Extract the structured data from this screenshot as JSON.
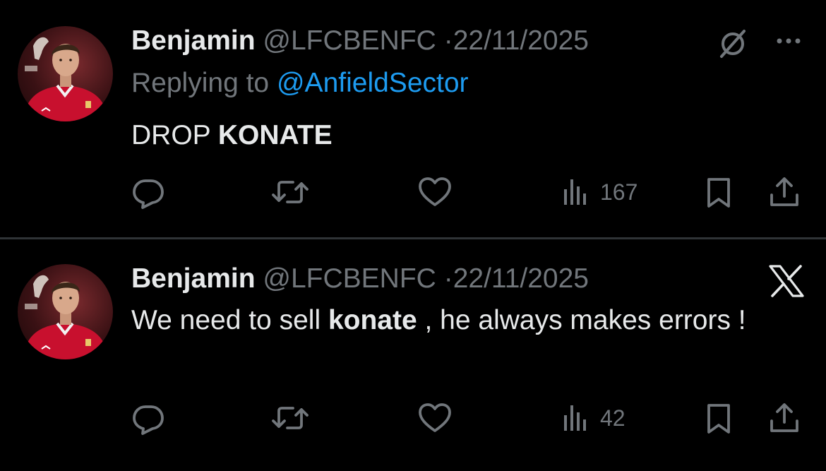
{
  "colors": {
    "background": "#000000",
    "text_primary": "#e7e9ea",
    "text_secondary": "#71767b",
    "link": "#1d9bf0",
    "divider": "#2f3336"
  },
  "tweets": [
    {
      "author": {
        "name": "Benjamin",
        "handle": "@LFCBENFC",
        "separator": "·",
        "date": "22/11/2025"
      },
      "reply_to": {
        "prefix": "Replying to",
        "mention": "@AnfieldSector"
      },
      "text": {
        "before": "DROP",
        "emphasis": "KONATE",
        "after": ""
      },
      "top_icons": [
        "grok-icon",
        "more-icon"
      ],
      "actions": {
        "icons": [
          "reply-icon",
          "retweet-icon",
          "like-icon",
          "views-icon",
          "bookmark-icon",
          "share-icon"
        ],
        "views": "167"
      }
    },
    {
      "author": {
        "name": "Benjamin",
        "handle": "@LFCBENFC",
        "separator": "·",
        "date": "22/11/2025"
      },
      "text": {
        "before": "We need to sell",
        "emphasis": "konate",
        "after": ", he always makes errors !"
      },
      "top_icons": [
        "x-logo-icon"
      ],
      "actions": {
        "icons": [
          "reply-icon",
          "retweet-icon",
          "like-icon",
          "views-icon",
          "bookmark-icon",
          "share-icon"
        ],
        "views": "42"
      }
    }
  ]
}
